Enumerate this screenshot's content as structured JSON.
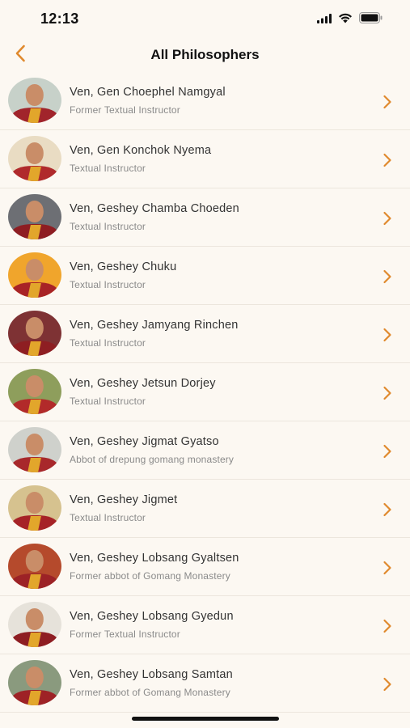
{
  "status_bar": {
    "time": "12:13"
  },
  "nav": {
    "title": "All Philosophers"
  },
  "accent_color": "#e08a2e",
  "philosophers": [
    {
      "name": "Ven, Gen Choephel Namgyal",
      "role": "Former Textual Instructor"
    },
    {
      "name": "Ven, Gen Konchok Nyema",
      "role": "Textual Instructor"
    },
    {
      "name": "Ven, Geshey Chamba Choeden",
      "role": "Textual Instructor"
    },
    {
      "name": "Ven, Geshey Chuku",
      "role": "Textual Instructor"
    },
    {
      "name": "Ven, Geshey Jamyang Rinchen",
      "role": "Textual Instructor"
    },
    {
      "name": "Ven, Geshey Jetsun Dorjey",
      "role": "Textual Instructor"
    },
    {
      "name": "Ven, Geshey Jigmat Gyatso",
      "role": "Abbot of drepung gomang monastery"
    },
    {
      "name": "Ven, Geshey Jigmet",
      "role": "Textual Instructor"
    },
    {
      "name": "Ven, Geshey Lobsang Gyaltsen",
      "role": "Former abbot of Gomang Monastery"
    },
    {
      "name": "Ven, Geshey Lobsang Gyedun",
      "role": "Former Textual Instructor"
    },
    {
      "name": "Ven, Geshey Lobsang Samtan",
      "role": "Former abbot of Gomang Monastery"
    }
  ]
}
